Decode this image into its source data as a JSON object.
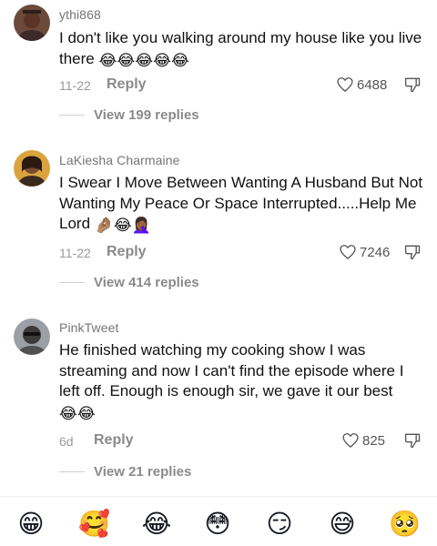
{
  "comments": [
    {
      "username": "ythi868",
      "text": "I don't like you walking around my house like you live there",
      "emojis": "😂😂😂😂😂",
      "date": "11-22",
      "reply_label": "Reply",
      "likes": "6488",
      "view_replies": "View 199 replies",
      "avatar_icon": "profile-photo"
    },
    {
      "username": "LaKiesha Charmaine",
      "text": "I Swear I Move Between Wanting A Husband But Not Wanting My Peace Or Space Interrupted.....Help Me Lord",
      "emojis": "🤌🏽😂🤦🏾‍♀️",
      "date": "11-22",
      "reply_label": "Reply",
      "likes": "7246",
      "view_replies": "View 414 replies",
      "avatar_icon": "profile-photo"
    },
    {
      "username": "PinkTweet",
      "text": "He finished watching my cooking show I was streaming and now I can't find the episode where I left off. Enough is enough sir, we gave it our best",
      "emojis": "😂😂",
      "date": "6d",
      "reply_label": "Reply",
      "likes": "825",
      "view_replies": "View 21 replies",
      "avatar_icon": "profile-photo"
    }
  ],
  "emoji_bar": [
    "😁",
    "🥰",
    "😂",
    "😳",
    "😏",
    "😅",
    "🥺"
  ],
  "icons": {
    "like": "heart-outline-icon",
    "dislike": "thumbs-down-outline-icon"
  },
  "colors": {
    "username": "#757575",
    "body": "#111111",
    "meta": "#9a9a9a",
    "divider": "#ededed"
  }
}
